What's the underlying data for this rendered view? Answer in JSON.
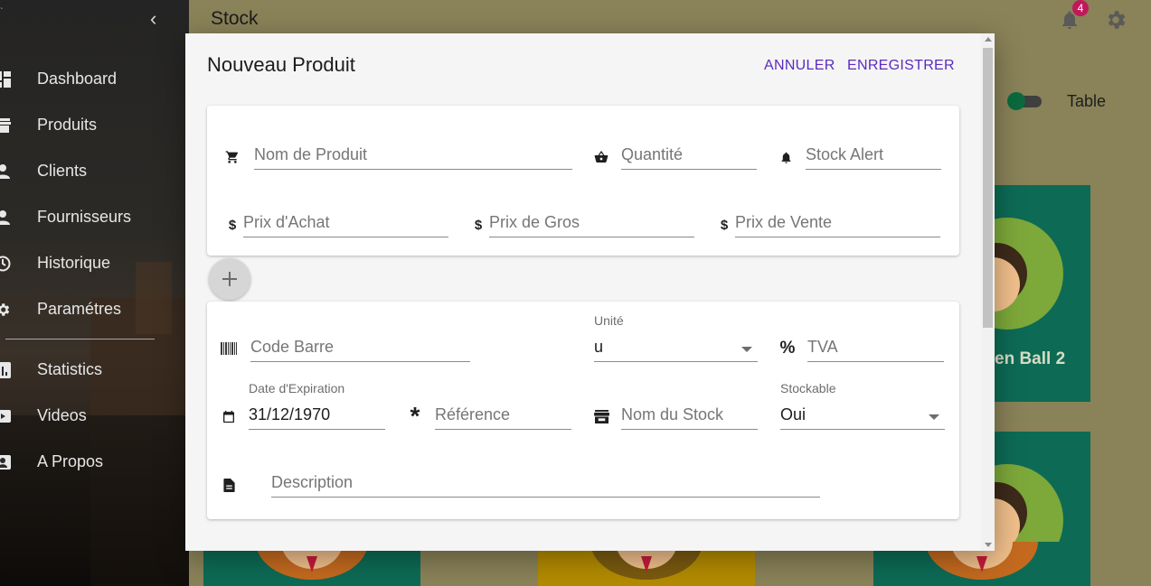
{
  "sidebar": {
    "items": [
      {
        "label": "Dashboard",
        "icon": "dashboard-icon"
      },
      {
        "label": "Produits",
        "icon": "store-icon"
      },
      {
        "label": "Clients",
        "icon": "person-icon"
      },
      {
        "label": "Fournisseurs",
        "icon": "person-icon"
      },
      {
        "label": "Historique",
        "icon": "history-icon"
      },
      {
        "label": "Paramétres",
        "icon": "gear-icon"
      },
      {
        "label": "Statistics",
        "icon": "chart-icon"
      },
      {
        "label": "Videos",
        "icon": "video-icon"
      },
      {
        "label": "A Propos",
        "icon": "contact-icon"
      }
    ]
  },
  "appbar": {
    "title": "Stock",
    "notification_count": "4"
  },
  "background": {
    "view_toggle_label": "Table",
    "card_label": "en Ball 2"
  },
  "dialog": {
    "title": "Nouveau Produit",
    "cancel_label": "ANNULER",
    "save_label": "ENREGISTRER",
    "fields": {
      "product_name": {
        "placeholder": "Nom de Produit"
      },
      "quantity": {
        "placeholder": "Quantité"
      },
      "stock_alert": {
        "placeholder": "Stock Alert"
      },
      "purchase_price": {
        "placeholder": "Prix d'Achat"
      },
      "wholesale_price": {
        "placeholder": "Prix de Gros"
      },
      "sale_price": {
        "placeholder": "Prix de Vente"
      },
      "barcode": {
        "placeholder": "Code Barre"
      },
      "unit": {
        "label": "Unité",
        "value": "u"
      },
      "tva": {
        "placeholder": "TVA"
      },
      "expiration_date": {
        "label": "Date d'Expiration",
        "value": "31/12/1970"
      },
      "reference": {
        "placeholder": "Référence"
      },
      "stock_name": {
        "placeholder": "Nom du Stock"
      },
      "stockable": {
        "label": "Stockable",
        "value": "Oui"
      },
      "description": {
        "placeholder": "Description"
      }
    }
  },
  "colors": {
    "accent": "#5b2bbf",
    "badge": "#c2185b",
    "card_green": "#0d6b55",
    "card_yellow": "#b38b00"
  }
}
